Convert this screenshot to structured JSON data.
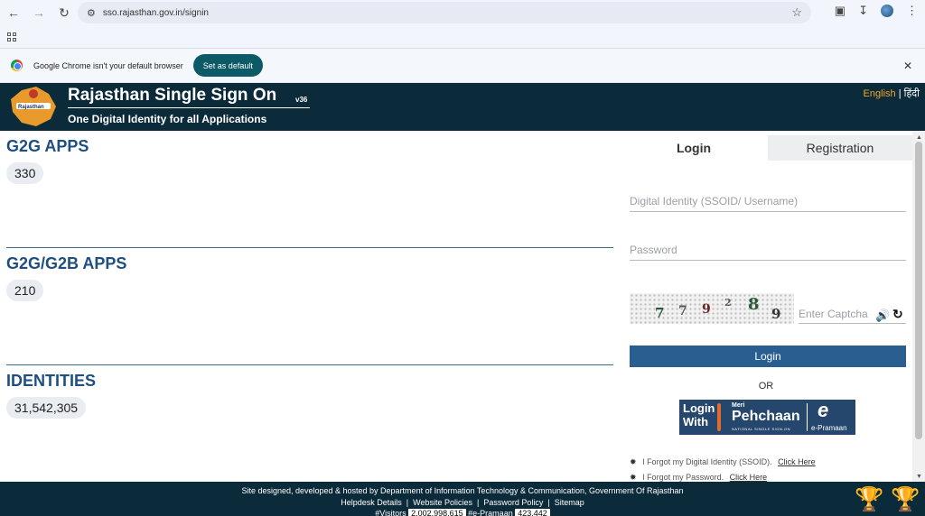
{
  "browser": {
    "url": "sso.rajasthan.gov.in/signin",
    "infobar_message": "Google Chrome isn't your default browser",
    "set_default_label": "Set as default"
  },
  "header": {
    "title": "Rajasthan Single Sign On",
    "version": "v36",
    "tagline": "One Digital Identity for all Applications",
    "lang_english": "English",
    "lang_separator": "|",
    "lang_hindi": "हिंदी",
    "logo_text": "Rajasthan"
  },
  "stats": [
    {
      "title": "G2G APPS",
      "value": "330"
    },
    {
      "title": "G2G/G2B APPS",
      "value": "210"
    },
    {
      "title": "IDENTITIES",
      "value": "31,542,305"
    }
  ],
  "login": {
    "tab_login": "Login",
    "tab_registration": "Registration",
    "username_placeholder": "Digital Identity (SSOID/ Username)",
    "password_placeholder": "Password",
    "captcha_placeholder": "Enter Captcha",
    "captcha_chars": [
      "7",
      "7",
      "9",
      "2",
      "8",
      "9"
    ],
    "login_button": "Login",
    "or_text": "OR",
    "pehchaan_login": "Login",
    "pehchaan_with": "With",
    "pehchaan_meri": "Meri",
    "pehchaan_name": "Pehchaan",
    "pehchaan_sub": "NATIONAL SINGLE SIGN-ON",
    "epramaan": "e-Pramaan",
    "forgot_ssoid_text": "I Forgot my Digital Identity (SSOID).",
    "forgot_ssoid_link": "Click Here",
    "forgot_password_text": "I Forgot my Password.",
    "forgot_password_link": "Click Here"
  },
  "footer": {
    "line1": "Site designed, developed & hosted by Department of Information Technology & Communication, Government Of Rajasthan",
    "helpdesk": "Helpdesk Details",
    "policies": "Website Policies",
    "password_policy": "Password Policy",
    "sitemap": "Sitemap",
    "visitors_label": "#Visitors",
    "visitors_count": "2,002,998,615",
    "epramaan_label": "#e-Pramaan",
    "epramaan_count": "423,442"
  },
  "colors": {
    "header_bg": "#0b2a3a",
    "stat_title": "#1e4f80",
    "login_button": "#2a5d90",
    "lang_active": "#f5a623"
  }
}
